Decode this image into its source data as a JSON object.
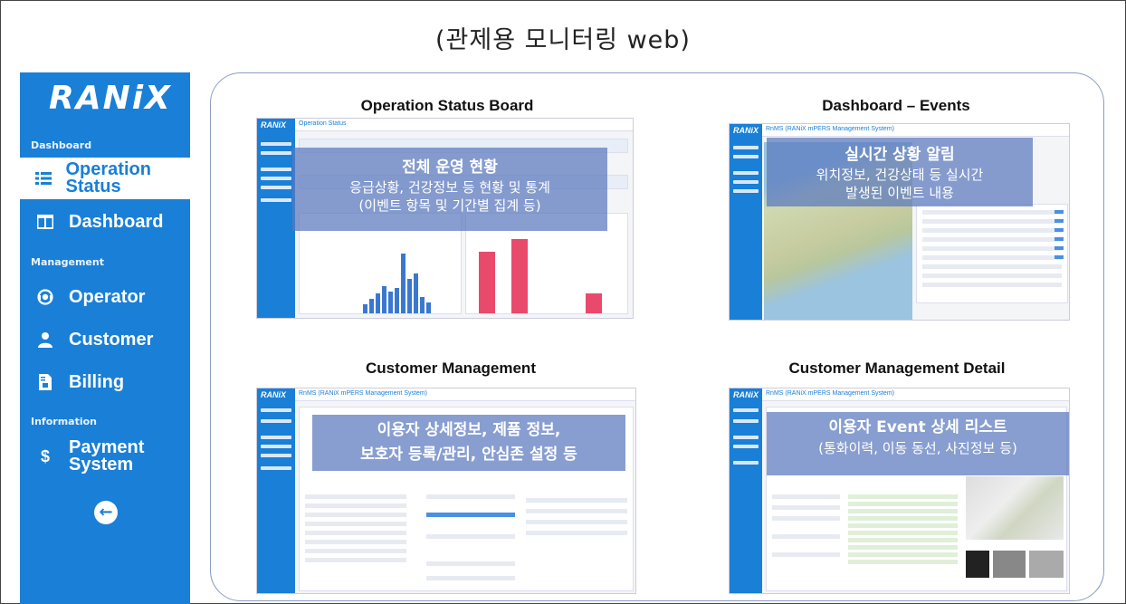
{
  "page_title": "(관제용 모니터링 web)",
  "sidebar": {
    "logo": "RANiX",
    "sections": {
      "dashboard": "Dashboard",
      "management": "Management",
      "information": "Information"
    },
    "items": [
      {
        "label": "Operation Status",
        "icon": "table-list-icon",
        "active": true
      },
      {
        "label": "Dashboard",
        "icon": "columns-icon"
      },
      {
        "label": "Operator",
        "icon": "headset-icon"
      },
      {
        "label": "Customer",
        "icon": "user-icon"
      },
      {
        "label": "Billing",
        "icon": "invoice-icon"
      },
      {
        "label": "Payment System",
        "icon": "dollar-icon"
      }
    ],
    "back_icon": "arrow-left-circle-icon"
  },
  "panels": [
    {
      "title": "Operation Status Board",
      "screen_header": "Operation Status",
      "overlay_title": "전체 운영 현황",
      "overlay_lines": [
        "응급상황, 건강정보 등 현황 및 통계",
        "(이벤트 항목 및 기간별 집계 등)"
      ]
    },
    {
      "title": "Dashboard – Events",
      "screen_header": "RnMS (RANiX mPERS Management System)",
      "overlay_title": "실시간 상황 알림",
      "overlay_lines": [
        "위치정보, 건강상태 등 실시간",
        "발생된 이벤트 내용"
      ]
    },
    {
      "title": "Customer Management",
      "screen_header": "RnMS (RANiX mPERS Management System)",
      "overlay_title": "이용자 상세정보, 제품 정보,",
      "overlay_lines": [
        "보호자 등록/관리, 안심존 설정 등"
      ]
    },
    {
      "title": "Customer Management Detail",
      "screen_header": "RnMS (RANiX mPERS Management System)",
      "overlay_title": "이용자 Event 상세 리스트",
      "overlay_lines": [
        "(통화이력, 이동 동선, 사진정보 등)"
      ]
    }
  ],
  "colors": {
    "brand_blue": "#1a7fd6",
    "overlay": "#5a78be",
    "chart_blue": "#3a78d0",
    "chart_pink": "#e94a6c"
  }
}
